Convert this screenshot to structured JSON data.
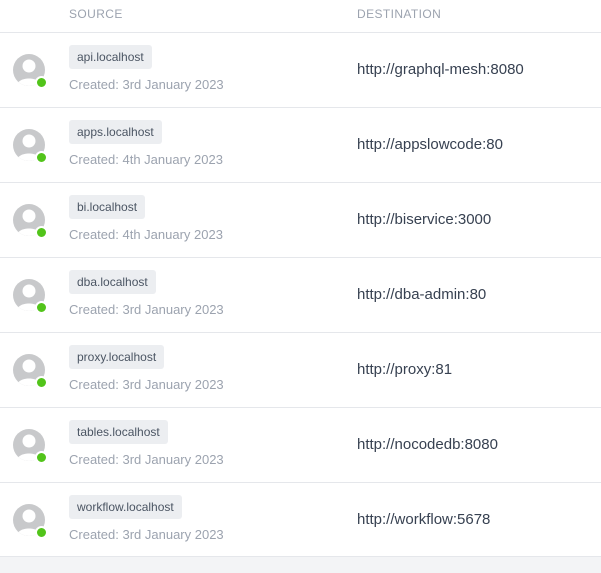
{
  "table": {
    "headers": {
      "source": "SOURCE",
      "destination": "DESTINATION"
    },
    "rows": [
      {
        "source_host": "api.localhost",
        "created": "Created: 3rd January 2023",
        "destination": "http://graphql-mesh:8080",
        "status": "online"
      },
      {
        "source_host": "apps.localhost",
        "created": "Created: 4th January 2023",
        "destination": "http://appslowcode:80",
        "status": "online"
      },
      {
        "source_host": "bi.localhost",
        "created": "Created: 4th January 2023",
        "destination": "http://biservice:3000",
        "status": "online"
      },
      {
        "source_host": "dba.localhost",
        "created": "Created: 3rd January 2023",
        "destination": "http://dba-admin:80",
        "status": "online"
      },
      {
        "source_host": "proxy.localhost",
        "created": "Created: 3rd January 2023",
        "destination": "http://proxy:81",
        "status": "online"
      },
      {
        "source_host": "tables.localhost",
        "created": "Created: 3rd January 2023",
        "destination": "http://nocodedb:8080",
        "status": "online"
      },
      {
        "source_host": "workflow.localhost",
        "created": "Created: 3rd January 2023",
        "destination": "http://workflow:5678",
        "status": "online"
      }
    ]
  },
  "colors": {
    "status_online": "#52c41a",
    "avatar_bg": "#c8c9cb",
    "badge_bg": "#eceef1",
    "header_text": "#9ca3af"
  },
  "icons": {
    "avatar": "user-avatar-icon",
    "status": "online-status-dot"
  }
}
